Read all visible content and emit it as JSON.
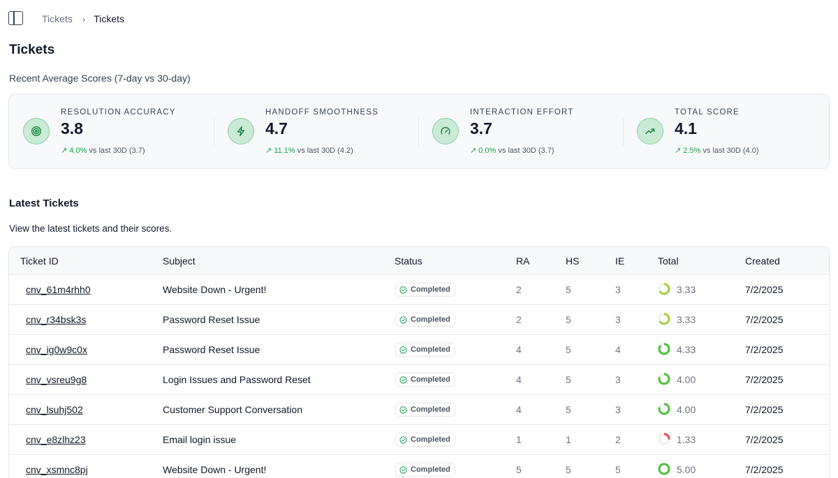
{
  "breadcrumb": {
    "parent": "Tickets",
    "current": "Tickets"
  },
  "page": {
    "title": "Tickets",
    "scores_subtitle": "Recent Average Scores (7-day vs 30-day)"
  },
  "metrics": [
    {
      "label": "RESOLUTION ACCURACY",
      "value": "3.8",
      "delta_pct": "4.0%",
      "delta_text": "vs last 30D (3.7)",
      "icon": "target-icon"
    },
    {
      "label": "HANDOFF SMOOTHNESS",
      "value": "4.7",
      "delta_pct": "11.1%",
      "delta_text": "vs last 30D (4.2)",
      "icon": "lightning-icon"
    },
    {
      "label": "INTERACTION EFFORT",
      "value": "3.7",
      "delta_pct": "0.0%",
      "delta_text": "vs last 30D (3.7)",
      "icon": "gauge-icon"
    },
    {
      "label": "TOTAL SCORE",
      "value": "4.1",
      "delta_pct": "2.5%",
      "delta_text": "vs last 30D (4.0)",
      "icon": "trending-up-icon"
    }
  ],
  "latest": {
    "title": "Latest Tickets",
    "subtitle": "View the latest tickets and their scores."
  },
  "table": {
    "columns": [
      "Ticket ID",
      "Subject",
      "Status",
      "RA",
      "HS",
      "IE",
      "Total",
      "Created"
    ],
    "rows": [
      {
        "id": "cnv_61m4rhh0",
        "subject": "Website Down - Urgent!",
        "status": "Completed",
        "ra": "2",
        "hs": "5",
        "ie": "3",
        "total": "3.33",
        "created": "7/2/2025"
      },
      {
        "id": "cnv_r34bsk3s",
        "subject": "Password Reset Issue",
        "status": "Completed",
        "ra": "2",
        "hs": "5",
        "ie": "3",
        "total": "3.33",
        "created": "7/2/2025"
      },
      {
        "id": "cnv_ig0w9c0x",
        "subject": "Password Reset Issue",
        "status": "Completed",
        "ra": "4",
        "hs": "5",
        "ie": "4",
        "total": "4.33",
        "created": "7/2/2025"
      },
      {
        "id": "cnv_vsreu9g8",
        "subject": "Login Issues and Password Reset",
        "status": "Completed",
        "ra": "4",
        "hs": "5",
        "ie": "3",
        "total": "4.00",
        "created": "7/2/2025"
      },
      {
        "id": "cnv_lsuhj502",
        "subject": "Customer Support Conversation",
        "status": "Completed",
        "ra": "4",
        "hs": "5",
        "ie": "3",
        "total": "4.00",
        "created": "7/2/2025"
      },
      {
        "id": "cnv_e8zlhz23",
        "subject": "Email login issue",
        "status": "Completed",
        "ra": "1",
        "hs": "1",
        "ie": "2",
        "total": "1.33",
        "created": "7/2/2025"
      },
      {
        "id": "cnv_xsmnc8pj",
        "subject": "Website Down - Urgent!",
        "status": "Completed",
        "ra": "5",
        "hs": "5",
        "ie": "5",
        "total": "5.00",
        "created": "7/2/2025"
      }
    ]
  },
  "colors": {
    "accent_green": "#16a34a",
    "ring_low": "#ef4444",
    "ring_mid": "#a3cc3c",
    "ring_high": "#4cc03a",
    "ring_track": "#eeeeee"
  }
}
